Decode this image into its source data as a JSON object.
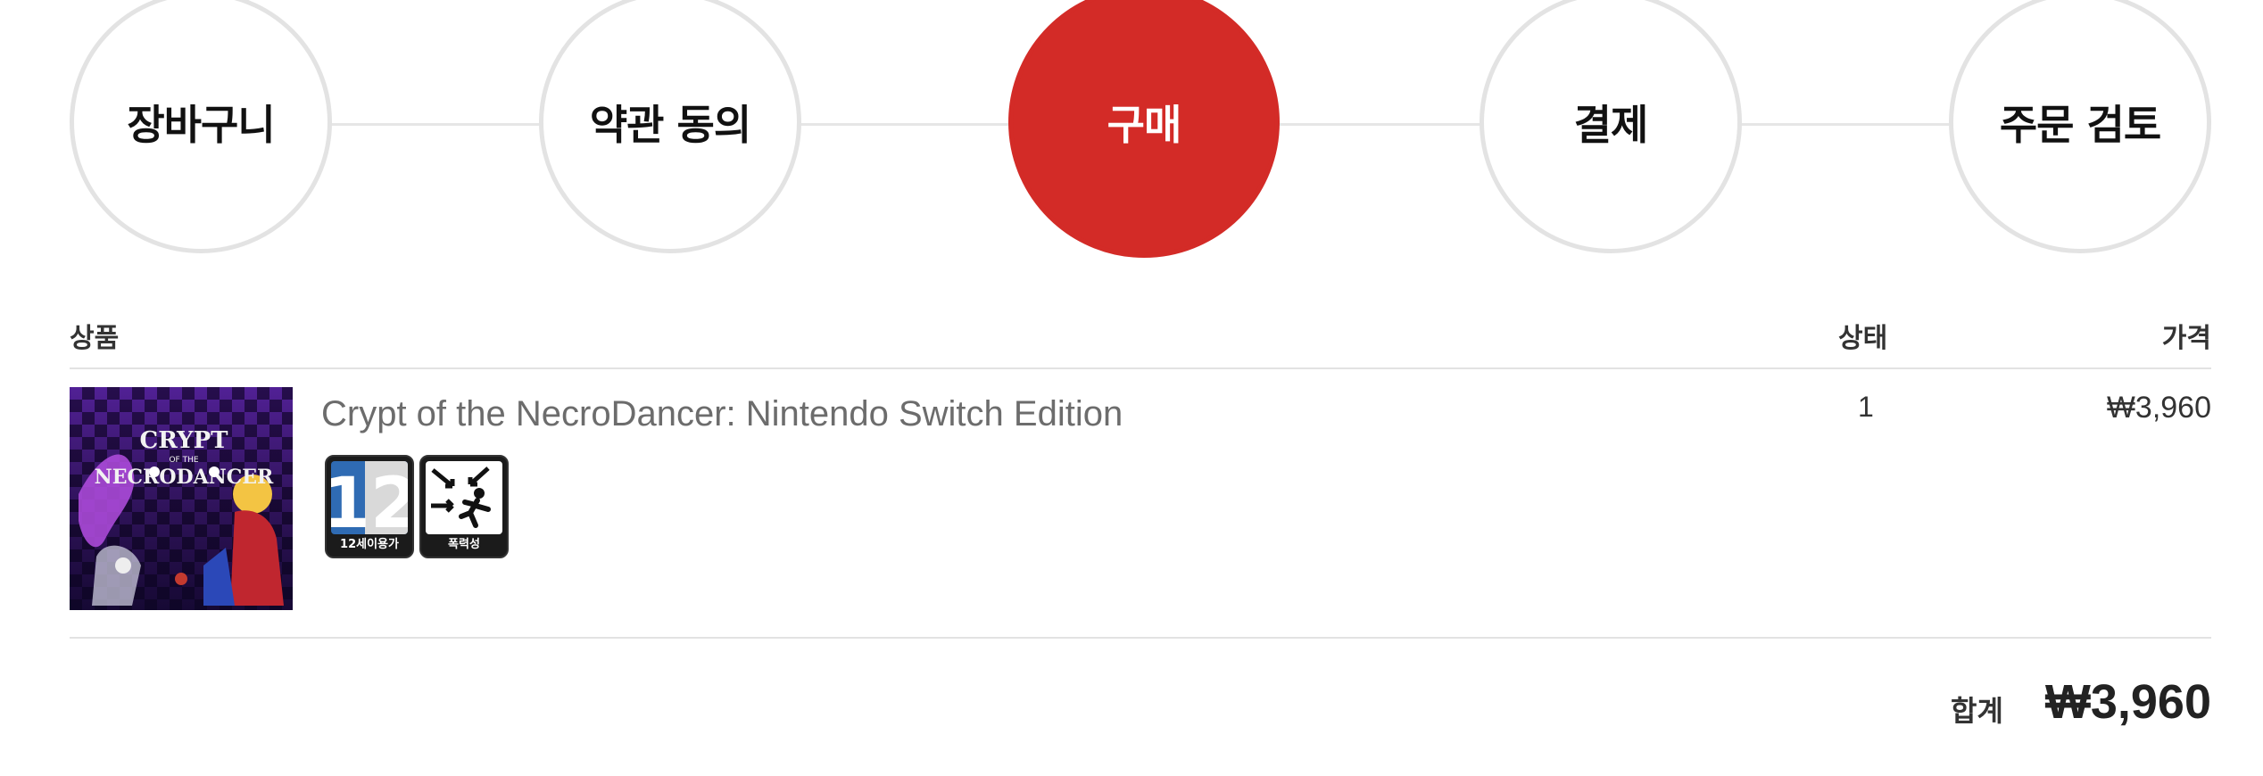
{
  "steps": [
    {
      "label": "장바구니",
      "active": false
    },
    {
      "label": "약관 동의",
      "active": false
    },
    {
      "label": "구매",
      "active": true
    },
    {
      "label": "결제",
      "active": false
    },
    {
      "label": "주문 검토",
      "active": false
    }
  ],
  "table": {
    "headers": {
      "product": "상품",
      "status": "상태",
      "price": "가격"
    },
    "items": [
      {
        "name": "Crypt of the NecroDancer: Nintendo Switch Edition",
        "thumbnail_title_line1": "CRYPT",
        "thumbnail_title_line2": "OF THE",
        "thumbnail_title_line3": "NECRODANCER",
        "rating_badge_caption": "12세이용가",
        "rating_badge_number": "12",
        "content_badge_caption": "폭력성",
        "quantity": "1",
        "price": "₩3,960"
      }
    ]
  },
  "summary": {
    "total_label": "합계",
    "total_value": "₩3,960"
  },
  "colors": {
    "active_step": "#d32b27",
    "step_border": "#e3e3e3",
    "divider": "#e2e2e2",
    "product_name": "#6c6c6c",
    "rating_blue": "#2f6bb3"
  },
  "icons": {
    "rating": "age-12-rating-icon",
    "content": "violence-descriptor-icon"
  }
}
